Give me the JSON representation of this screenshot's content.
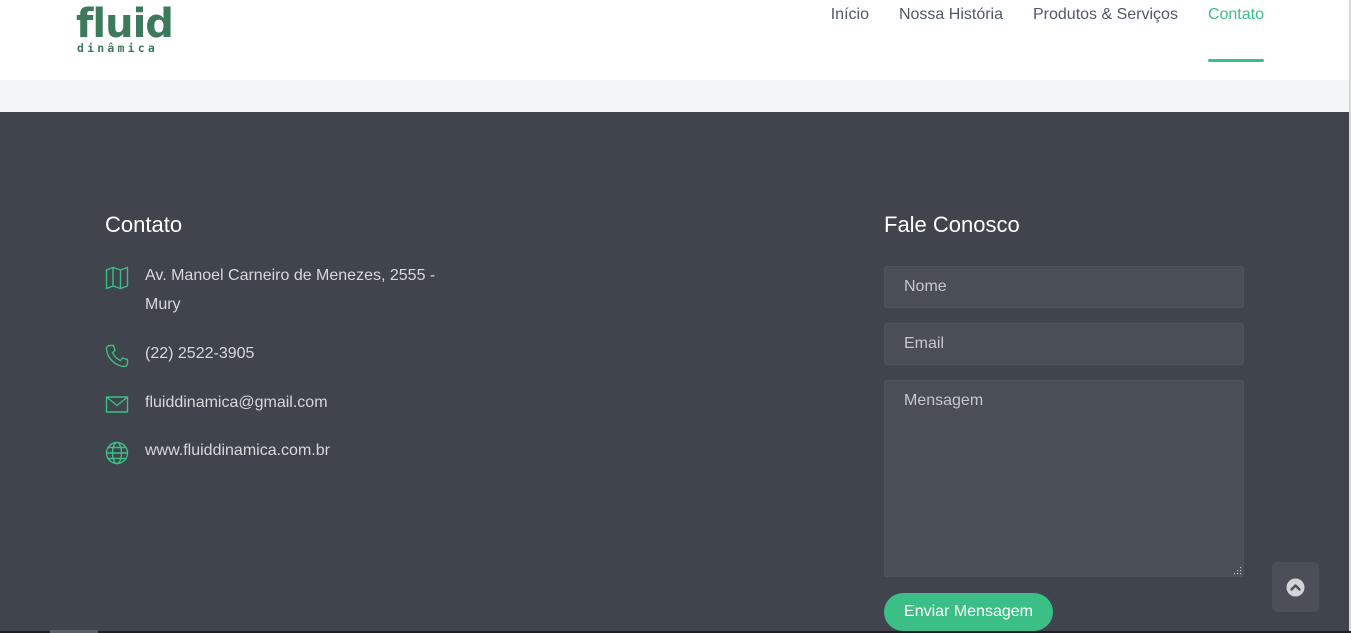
{
  "brand": {
    "logo_main": "fluid",
    "logo_sub": "dinâmica"
  },
  "nav": {
    "items": [
      {
        "label": "Início",
        "active": false
      },
      {
        "label": "Nossa História",
        "active": false
      },
      {
        "label": "Produtos & Serviços",
        "active": false
      },
      {
        "label": "Contato",
        "active": true
      }
    ]
  },
  "contact": {
    "title": "Contato",
    "address_line1": "Av. Manoel Carneiro de Menezes, 2555 -",
    "address_line2": "Mury",
    "phone": "(22) 2522-3905",
    "email": "fluiddinamica@gmail.com",
    "website": "www.fluiddinamica.com.br"
  },
  "form": {
    "title": "Fale Conosco",
    "name_placeholder": "Nome",
    "email_placeholder": "Email",
    "message_placeholder": "Mensagem",
    "submit_label": "Enviar Mensagem"
  },
  "icons": {
    "address": "map-icon",
    "phone": "phone-icon",
    "email": "envelope-icon",
    "website": "globe-icon",
    "back_to_top": "chevron-up-icon"
  },
  "colors": {
    "accent": "#3cbf86",
    "logo": "#3d7a5b",
    "footer_bg": "#40444c",
    "field_bg": "#4a4e57",
    "nav_text": "#515868"
  }
}
